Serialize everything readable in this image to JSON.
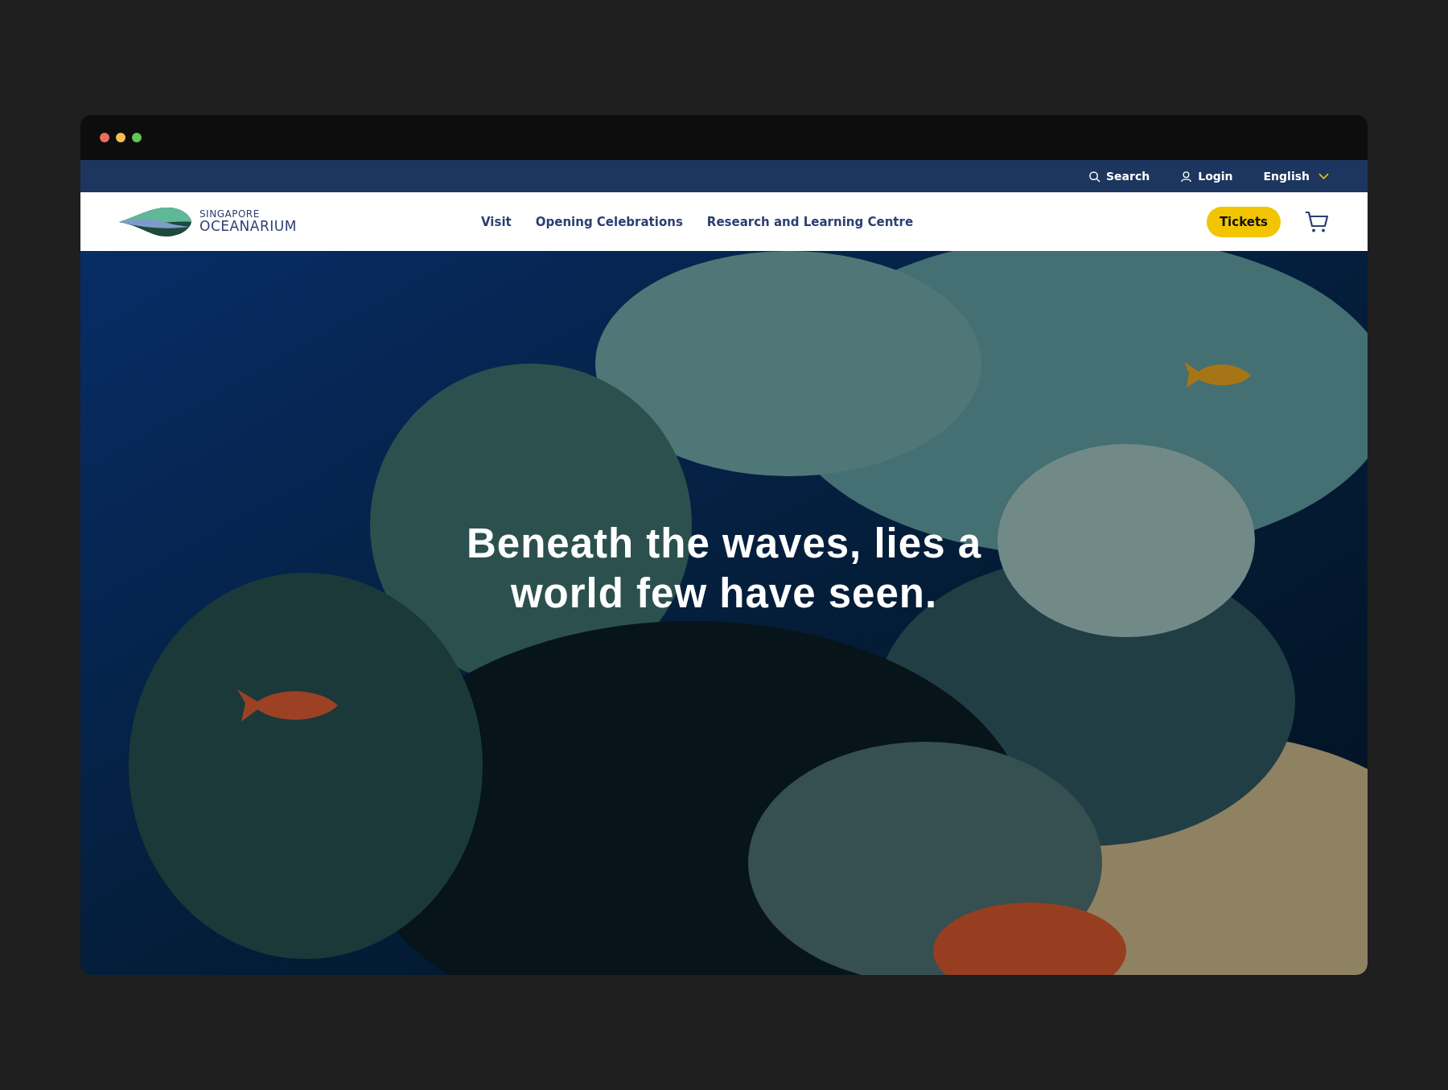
{
  "utility_bar": {
    "search": "Search",
    "login": "Login",
    "language": "English"
  },
  "brand": {
    "line_1": "SINGAPORE",
    "line_2": "OCEANARIUM"
  },
  "nav": [
    {
      "label": "Visit"
    },
    {
      "label": "Opening Celebrations"
    },
    {
      "label": "Research and Learning Centre"
    }
  ],
  "tickets_button": "Tickets",
  "hero": {
    "kind": "picture",
    "headline": "Beneath the waves, lies a world few have seen."
  }
}
